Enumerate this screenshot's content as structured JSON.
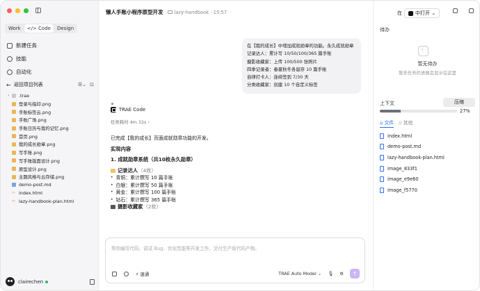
{
  "sidebar": {
    "modes": [
      "Work",
      "</> Code",
      "Design"
    ],
    "active_mode": 1,
    "menu": [
      {
        "label": "新建任务",
        "icon": "new-task-icon"
      },
      {
        "label": "技能",
        "icon": "skills-icon"
      },
      {
        "label": "自动化",
        "icon": "automation-icon"
      }
    ],
    "back_label": "返回项目列表",
    "files": [
      {
        "name": ".trae",
        "type": "folder"
      },
      {
        "name": "登录与指印.png",
        "type": "png"
      },
      {
        "name": "手账标签云.png",
        "type": "png"
      },
      {
        "name": "手账广场.png",
        "type": "png"
      },
      {
        "name": "手账日历与我的记忆.png",
        "type": "png"
      },
      {
        "name": "首页.png",
        "type": "png"
      },
      {
        "name": "我的成长勋章.png",
        "type": "png"
      },
      {
        "name": "写手账.png",
        "type": "png"
      },
      {
        "name": "写手账版面设计.png",
        "type": "png"
      },
      {
        "name": "原型设计.png",
        "type": "png"
      },
      {
        "name": "主题风格与云存储.png",
        "type": "png"
      },
      {
        "name": "demo-post.md",
        "type": "md"
      },
      {
        "name": "index.html",
        "type": "html"
      },
      {
        "name": "lazy-handbook-plan.html",
        "type": "html"
      }
    ],
    "user": "clairechen"
  },
  "main": {
    "title": "懒人手账小程序原型开发",
    "crumb": "lazy-handbook · 15:57",
    "user_message": [
      "在【我的成长】中增加成就勋章的功能。永久成就勋章",
      "记录达人：累计写 10/50/100/365 篇手账",
      "摄影收藏家：上传 100/500 张照片",
      "四季记录者：春夏秋冬各留存 10 篇手账",
      "自律打卡人：连续签到 7/30 天",
      "分类收藏家：创建 10 个自定义标签"
    ],
    "agent_name": "TRAE Code",
    "elapsed": "任务耗时 4m 32s ›",
    "reply_intro": "已完成【我的成长】页面成就勋章功能的开发。",
    "reply_heading": "实现内容",
    "reply_sub": "1. 成就勋章系统（共10枚永久勋章）",
    "group1_label": "记录达人",
    "group1_count": "（4枚）",
    "group1_items": [
      "青铜：累计撰写 10 篇手账",
      "白银：累计撰写 50 篇手账",
      "黄金：累计撰写 100 篇手账",
      "钻石：累计撰写 365 篇手账"
    ],
    "group2_label": "摄影收藏家",
    "group2_count": "（2枚）",
    "composer_placeholder": "帮你编写代码、调试 Bug、优化性能等开发工作，交付生产级代码产物。",
    "speed_label": "速通",
    "model_label": "TRAE Auto Model ⌄"
  },
  "right": {
    "open_in_prefix": "在",
    "open_in_label": "中打开 ⌄",
    "todo_label": "待办",
    "empty_title": "暂无待办",
    "empty_sub": "暂未任务的进展会显示在这里",
    "context_label": "上下文",
    "compress_label": "压缩",
    "context_pct": "27%",
    "context_fraction": 0.27,
    "tabs": [
      "文件",
      "其他"
    ],
    "active_tab": 0,
    "context_files": [
      "index.html",
      "demo-post.md",
      "lazy-handbook-plan.html",
      "image_833f1",
      "image_e9e60",
      "image_f5770"
    ]
  },
  "colors": {
    "accent": "#2b6ef3",
    "send": "#c9b6f4",
    "traffic_red": "#ff5f57",
    "traffic_yellow": "#febc2e",
    "traffic_green": "#28c840"
  }
}
